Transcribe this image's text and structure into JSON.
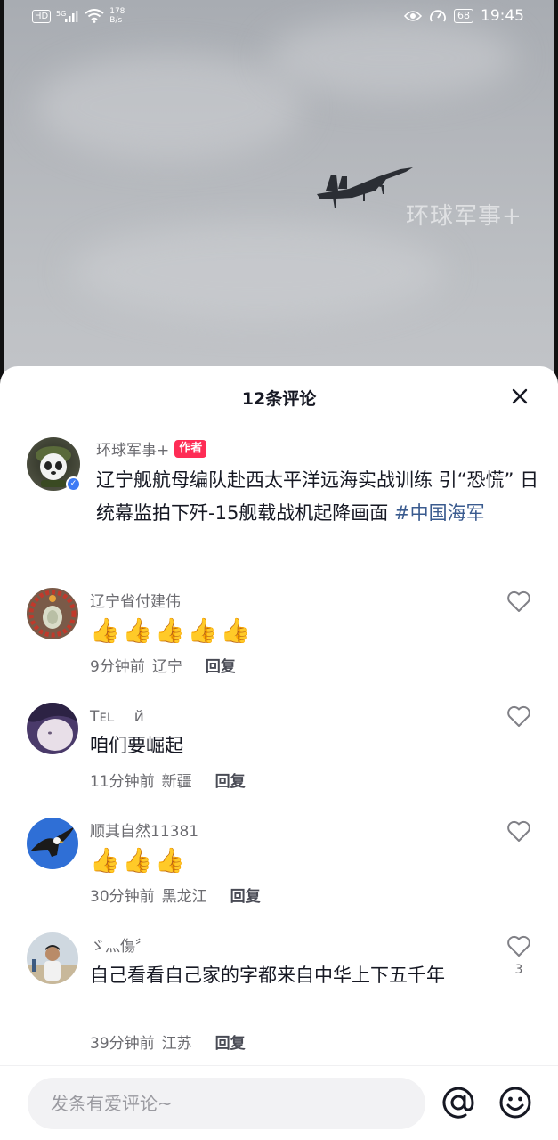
{
  "status_bar": {
    "hd": "HD",
    "signal": "5G",
    "net_speed_value": "178",
    "net_speed_unit": "B/s",
    "battery": "68",
    "time": "19:45"
  },
  "video": {
    "watermark": "环球军事+"
  },
  "sheet": {
    "title": "12条评论"
  },
  "author_post": {
    "name": "环球军事+",
    "badge": "作者",
    "text": "辽宁舰航母编队赴西太平洋远海实战训练 引“恐慌” 日统幕监拍下歼-15舰载战机起降画面 ",
    "hashtag": "#中国海军"
  },
  "comments": [
    {
      "name": "辽宁省付建伟",
      "text": "👍👍👍👍👍",
      "time": "9分钟前",
      "location": "辽宁",
      "reply": "回复",
      "likes": ""
    },
    {
      "name": "Tᴇʟ　 й",
      "text": "咱们要崛起",
      "time": "11分钟前",
      "location": "新疆",
      "reply": "回复",
      "likes": ""
    },
    {
      "name": "顺其自然11381",
      "text": "👍👍👍",
      "time": "30分钟前",
      "location": "黑龙江",
      "reply": "回复",
      "likes": ""
    },
    {
      "name": "ゞ灬傷〞",
      "text": "自己看看自己家的字都来自中华上下五千年",
      "time": "39分钟前",
      "location": "江苏",
      "reply": "回复",
      "likes": "3"
    }
  ],
  "input_bar": {
    "placeholder": "发条有爱评论~"
  },
  "colors": {
    "author_badge": "#fe2c55",
    "hashtag": "#3a5b8f",
    "verified": "#3d7bf5",
    "text_primary": "#161823",
    "text_secondary": "#6b6b70"
  }
}
